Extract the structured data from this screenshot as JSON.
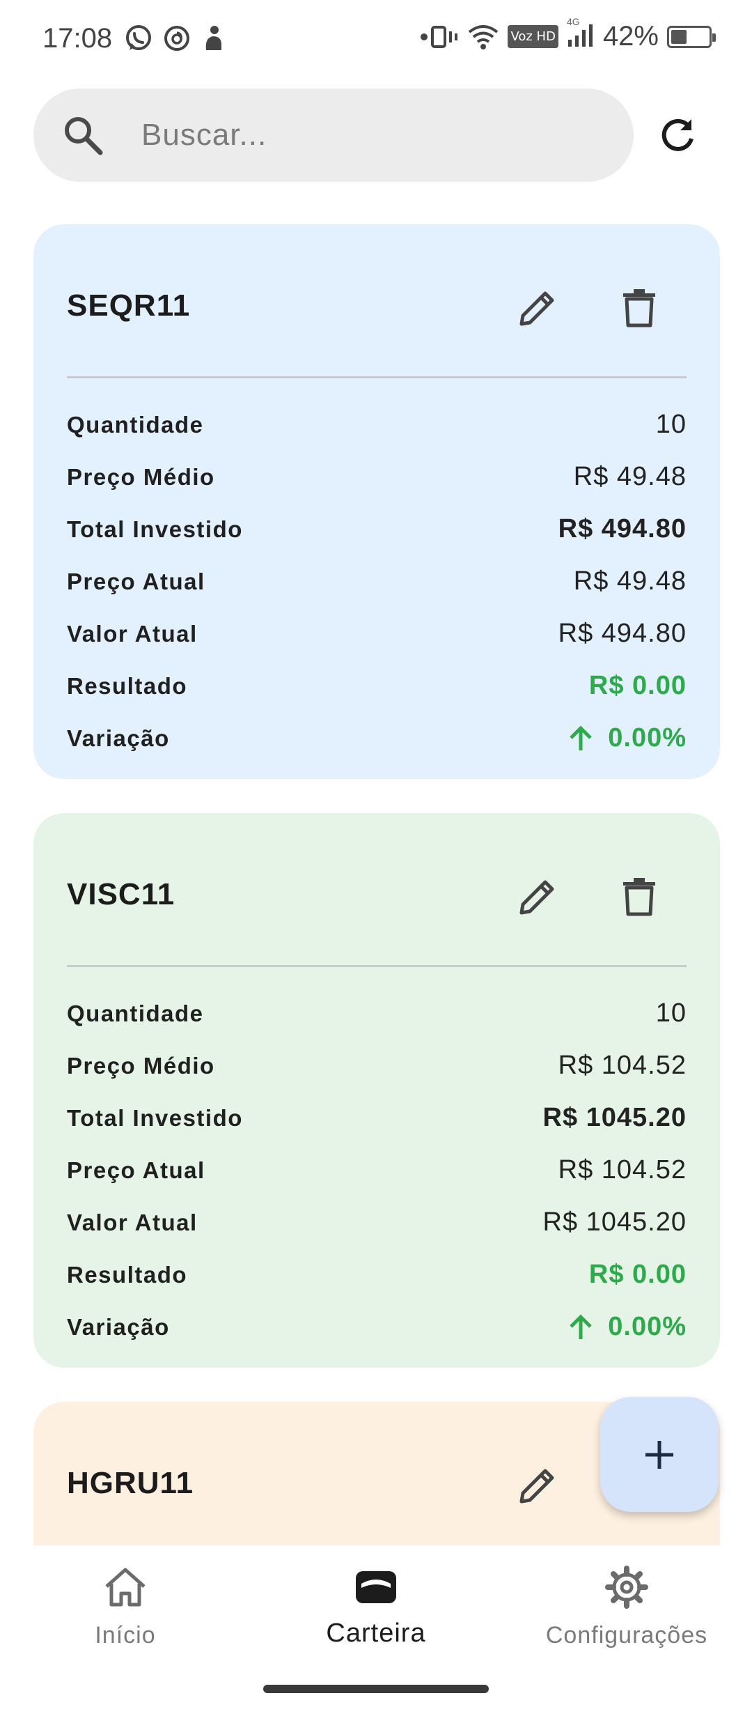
{
  "status_bar": {
    "time": "17:08",
    "network_badge": "Voz HD",
    "network_type": "4G",
    "battery_percent": "42%",
    "battery_level": 0.42,
    "left_icons": [
      "whatsapp-icon",
      "threads-icon",
      "notification-app-icon"
    ],
    "right_icons": [
      "vibrate-icon",
      "wifi-icon",
      "signal-icon",
      "battery-icon"
    ]
  },
  "search": {
    "placeholder": "Buscar...",
    "value": ""
  },
  "labels": {
    "quantity": "Quantidade",
    "avg_price": "Preço Médio",
    "total_invested": "Total Investido",
    "current_price": "Preço Atual",
    "current_value": "Valor Atual",
    "result": "Resultado",
    "variation": "Variação"
  },
  "assets": [
    {
      "ticker": "SEQR11",
      "background": "#e3f0fd",
      "quantity": "10",
      "avg_price": "R$ 49.48",
      "total_invested": "R$ 494.80",
      "current_price": "R$ 49.48",
      "current_value": "R$ 494.80",
      "result": "R$ 0.00",
      "variation": "0.00%"
    },
    {
      "ticker": "VISC11",
      "background": "#e6f4e8",
      "quantity": "10",
      "avg_price": "R$ 104.52",
      "total_invested": "R$ 1045.20",
      "current_price": "R$ 104.52",
      "current_value": "R$ 1045.20",
      "result": "R$ 0.00",
      "variation": "0.00%"
    },
    {
      "ticker": "HGRU11",
      "background": "#fdf0e0"
    }
  ],
  "colors": {
    "positive": "#2eaa4c",
    "fab_background": "#d5e3fb",
    "search_background": "#ececec"
  },
  "bottom_nav": {
    "items": [
      {
        "label": "Início",
        "icon": "home-icon",
        "active": false
      },
      {
        "label": "Carteira",
        "icon": "wallet-icon",
        "active": true
      },
      {
        "label": "Configurações",
        "icon": "gear-icon",
        "active": false
      }
    ]
  }
}
